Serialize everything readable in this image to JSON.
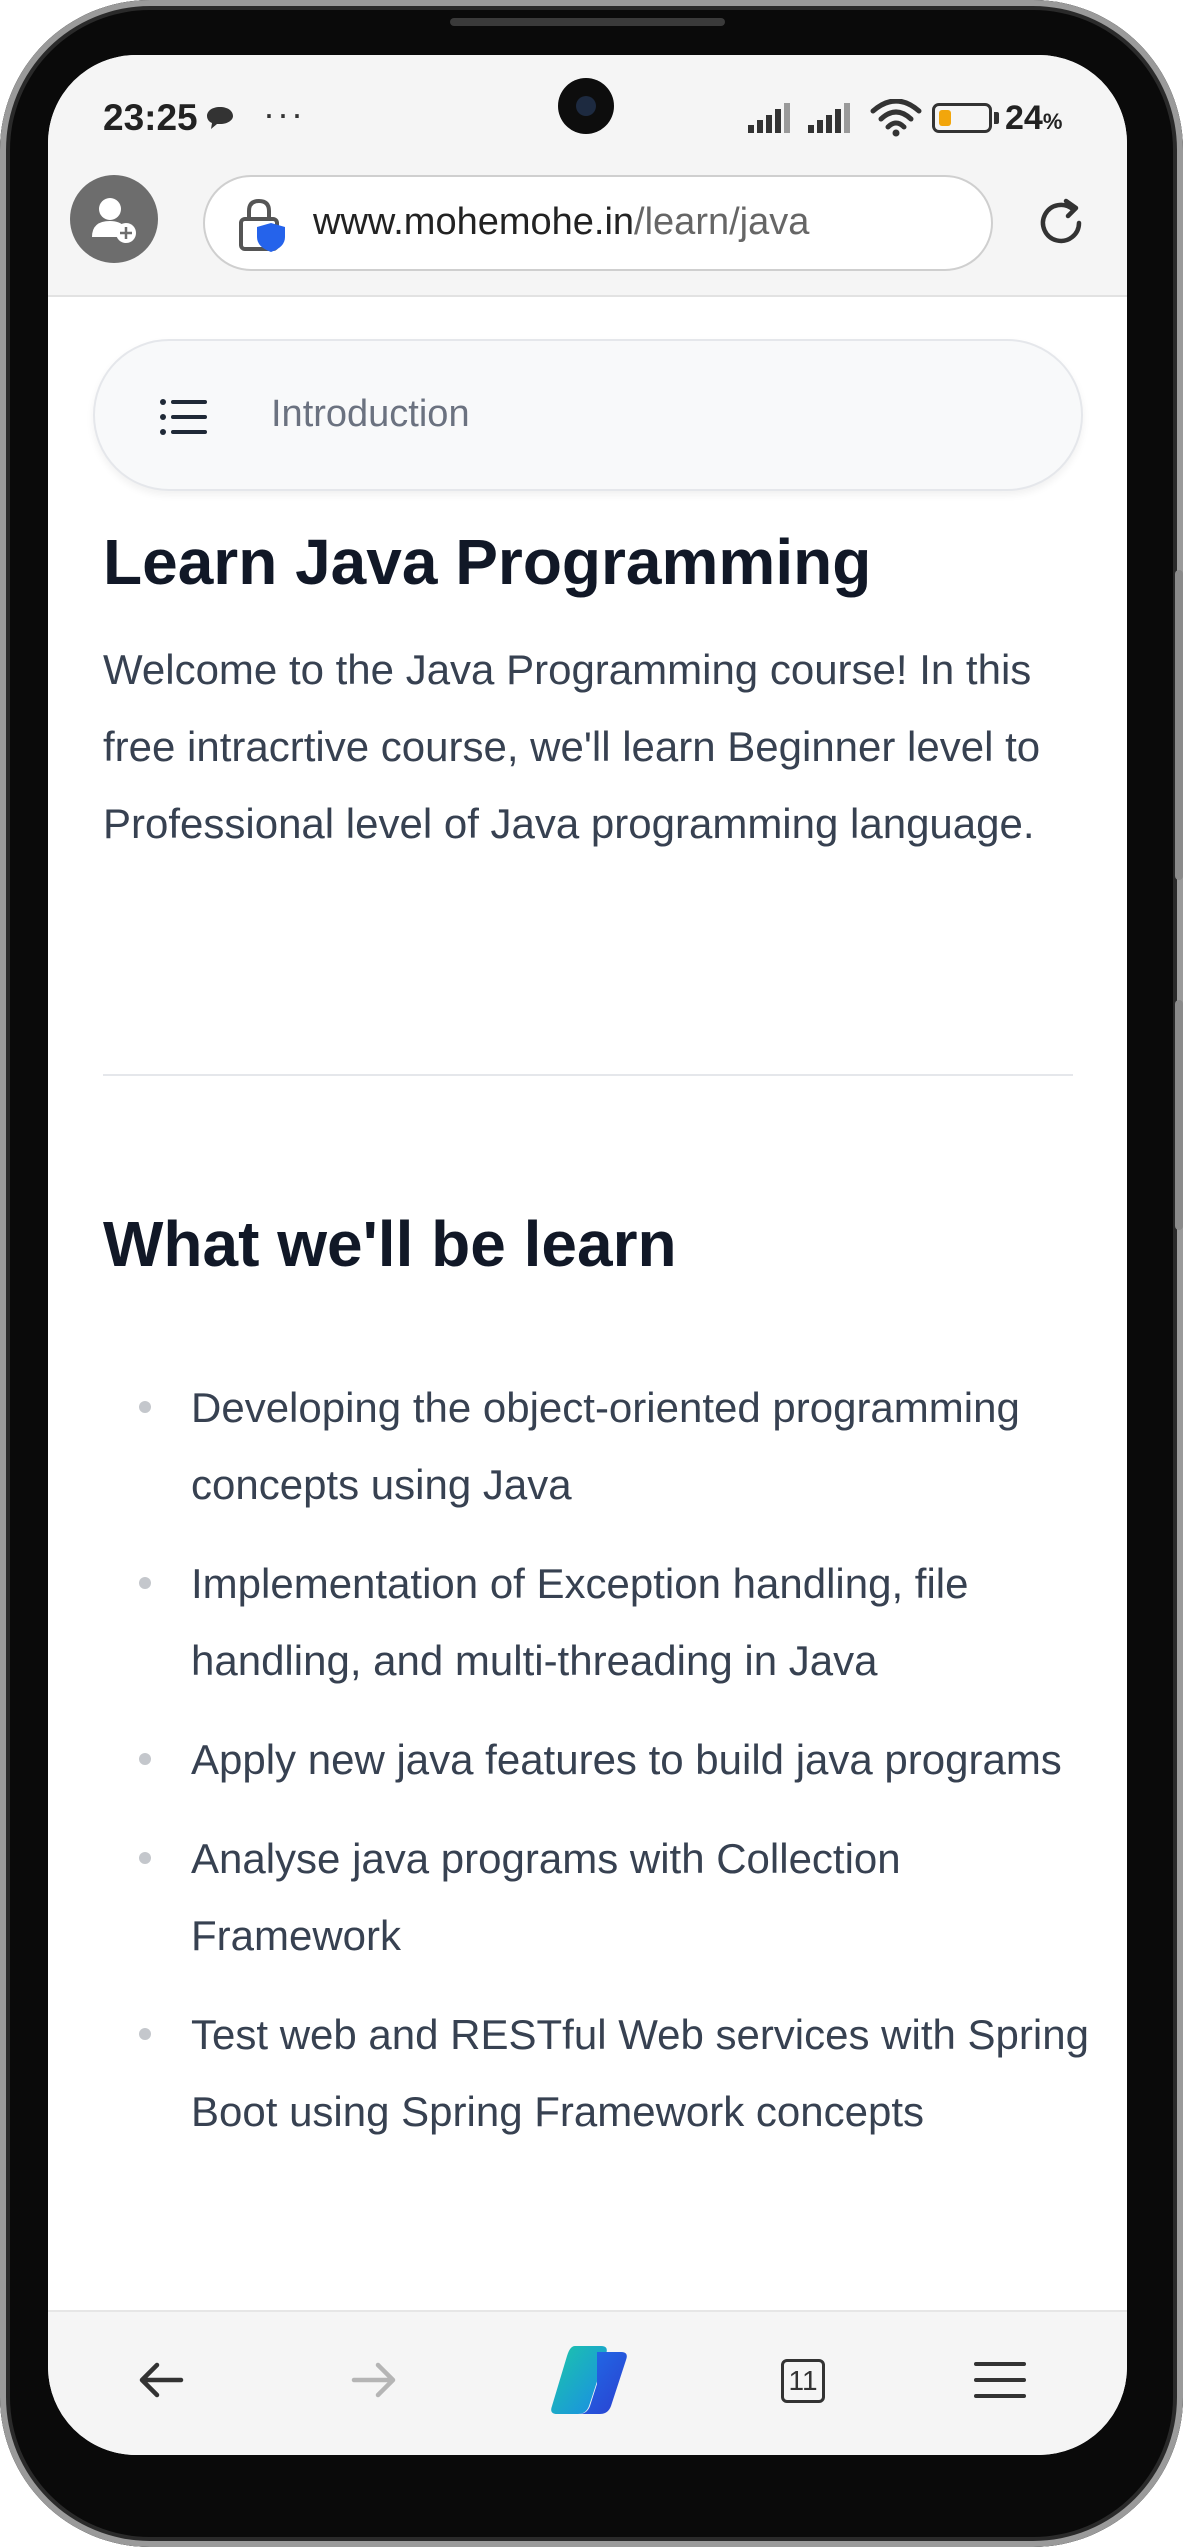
{
  "status_bar": {
    "time": "23:25",
    "more": "···",
    "battery_percent": "24",
    "battery_unit": "%",
    "battery_level": 0.24
  },
  "browser": {
    "url_host": "www.mohemohe.in",
    "url_path": "/learn/java"
  },
  "page": {
    "nav_label": "Introduction",
    "title": "Learn Java Programming",
    "intro": "Welcome to the Java Programming course! In this free intracrtive course, we'll learn Beginner level to Professional level of Java programming language.",
    "section_title": "What we'll be learn",
    "bullets": [
      "Developing the object-oriented programming concepts using Java",
      "Implementation of Exception handling, file handling, and multi-threading in Java",
      "Apply new java features to build java programs",
      "Analyse java programs with Collection Framework",
      "Test web and RESTful Web services with Spring Boot using Spring Framework concepts"
    ]
  },
  "bottom_bar": {
    "tab_count": "11"
  },
  "colors": {
    "heading": "#111827",
    "body_text": "#374151",
    "muted_text": "#6b7280",
    "battery_fill": "#f2a60c",
    "shield": "#2563eb"
  }
}
